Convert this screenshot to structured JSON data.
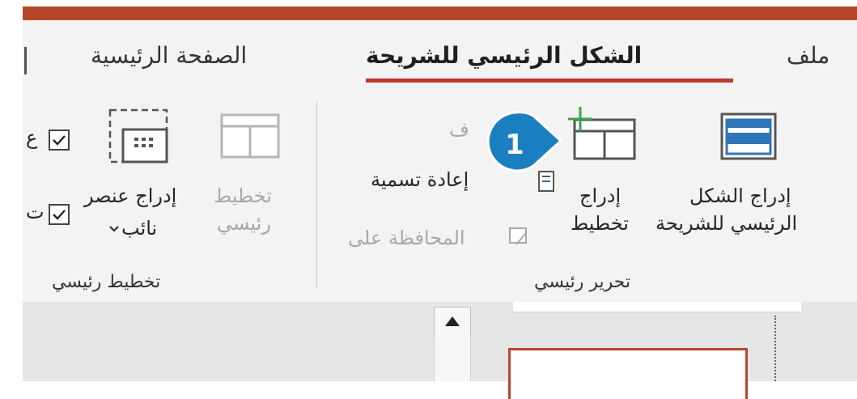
{
  "tabs": {
    "file": "ملف",
    "slide_master": "الشكل الرئيسي للشريحة",
    "home": "الصفحة الرئيسية"
  },
  "edit_master": {
    "insert_slide_master_line1": "إدراج الشكل",
    "insert_slide_master_line2": "الرئيسي للشريحة",
    "insert_layout_line1": "إدراج",
    "insert_layout_line2": "تخطيط",
    "delete_partial": "ف",
    "rename": "إعادة تسمية",
    "preserve_partial": "المحافظة على",
    "group_label": "تحرير رئيسي"
  },
  "master_layout": {
    "master_layout_line1": "تخطيط",
    "master_layout_line2": "رئيسي",
    "insert_placeholder_line1": "إدراج عنصر",
    "insert_placeholder_line2": "نائب",
    "check1_partial": "ع",
    "check2_partial": "ت",
    "group_label": "تخطيط رئيسي"
  },
  "step_badge": "1",
  "colors": {
    "accent": "#b7472a",
    "tab_underline": "#c0392b",
    "badge": "#1a7fc1",
    "icon_blue": "#2e75b6"
  },
  "icons": [
    "slide-master-icon",
    "insert-layout-icon",
    "rename-icon",
    "preserve-icon",
    "master-layout-icon",
    "placeholder-icon",
    "checkbox-icon",
    "dropdown-chevron-icon",
    "scroll-up-arrow-icon"
  ]
}
